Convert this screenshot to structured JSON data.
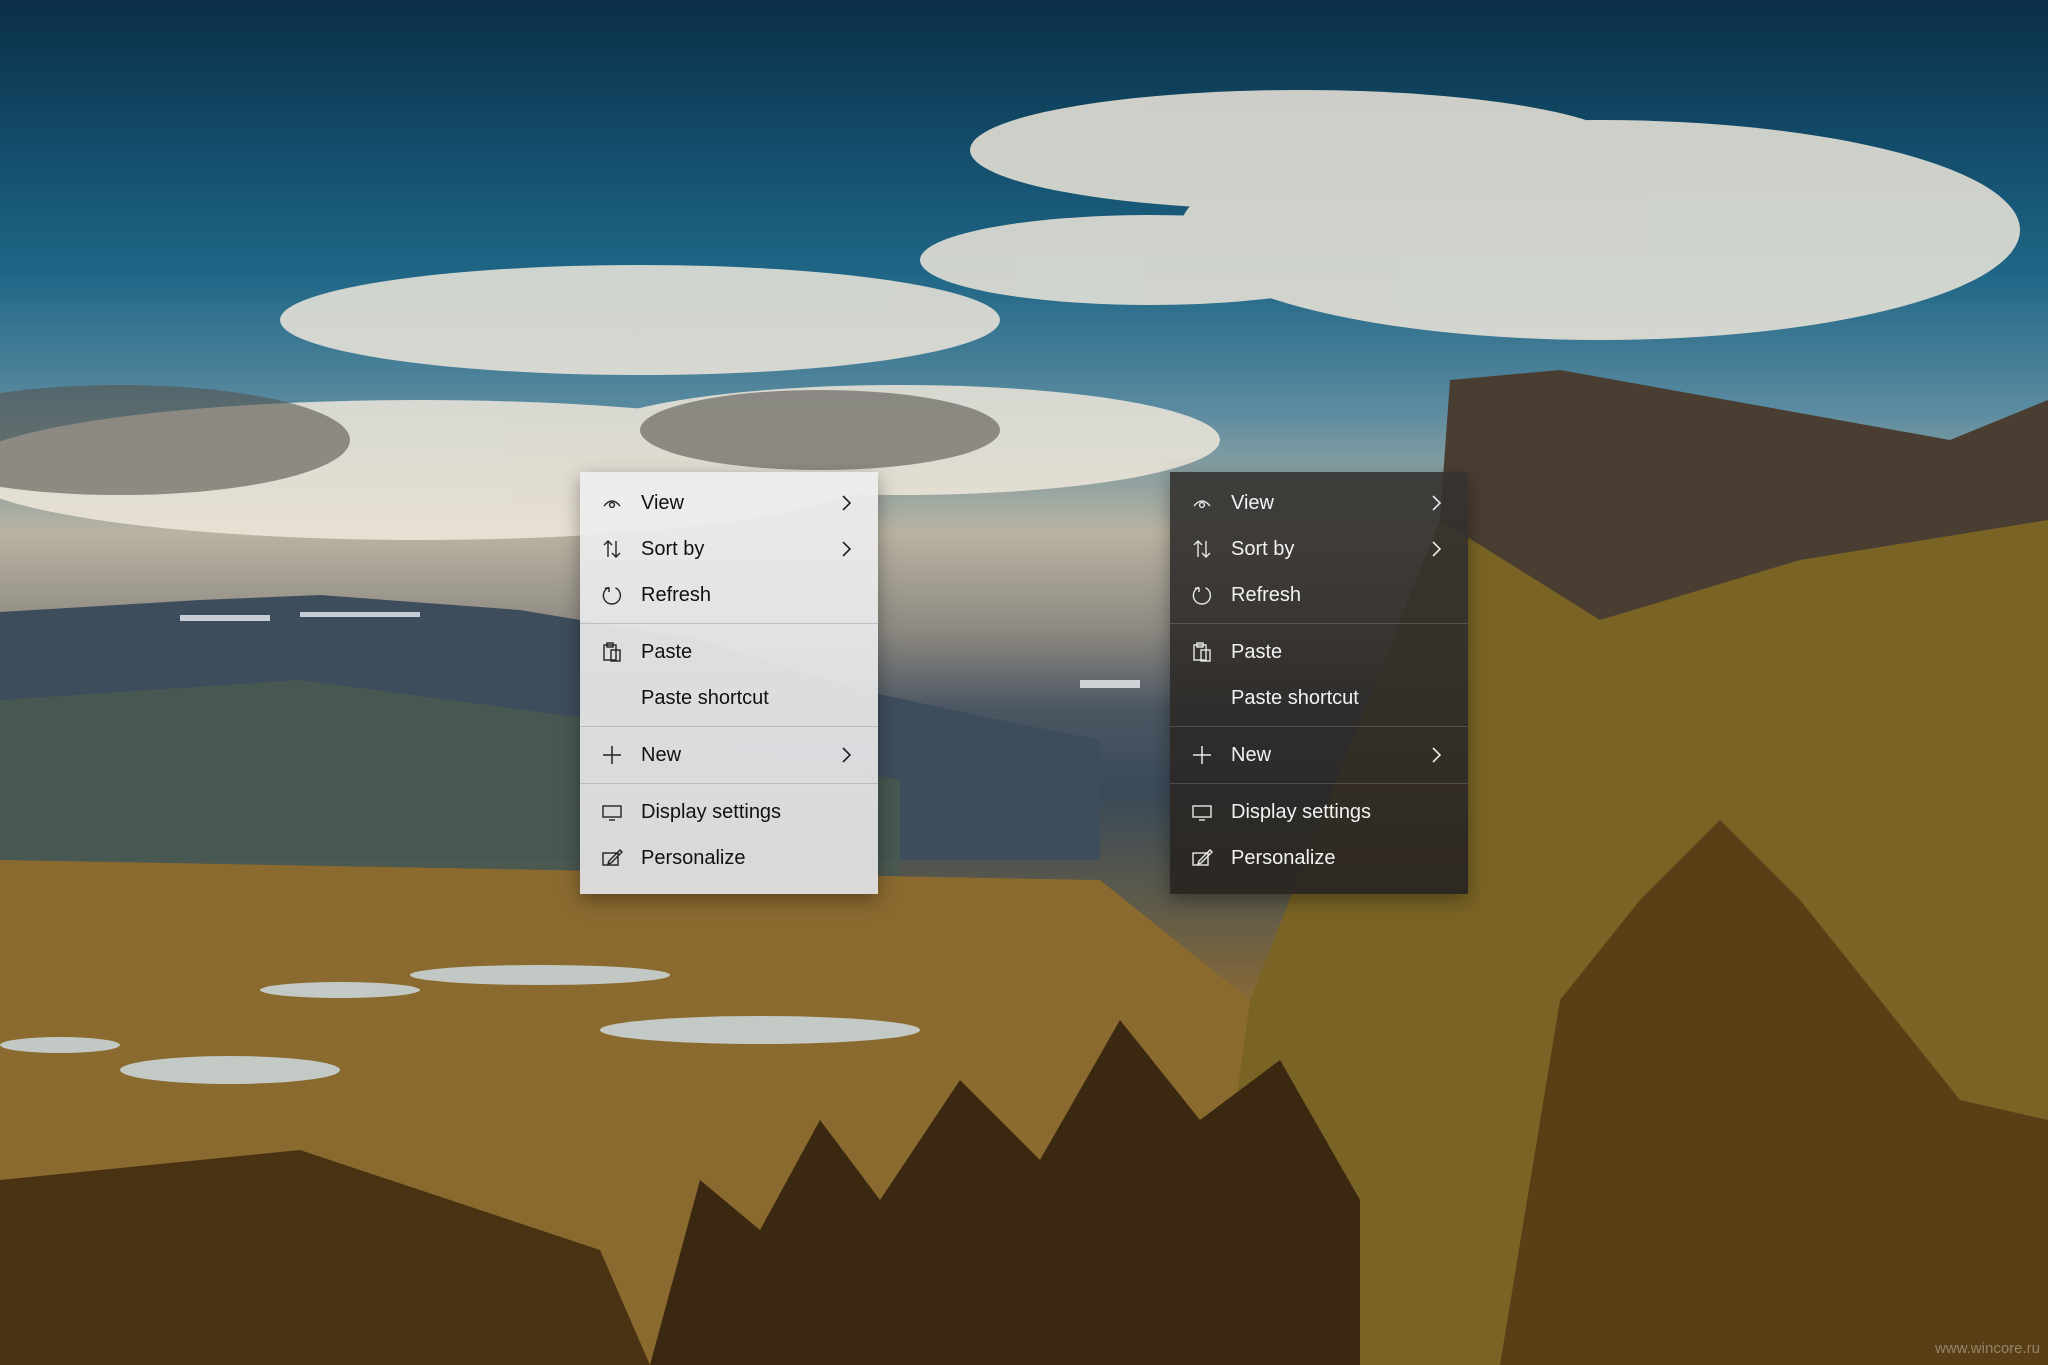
{
  "menus": {
    "light": {
      "theme": "light",
      "items": {
        "view": "View",
        "sort_by": "Sort by",
        "refresh": "Refresh",
        "paste": "Paste",
        "paste_shortcut": "Paste shortcut",
        "new": "New",
        "display_settings": "Display settings",
        "personalize": "Personalize"
      }
    },
    "dark": {
      "theme": "dark",
      "items": {
        "view": "View",
        "sort_by": "Sort by",
        "refresh": "Refresh",
        "paste": "Paste",
        "paste_shortcut": "Paste shortcut",
        "new": "New",
        "display_settings": "Display settings",
        "personalize": "Personalize"
      }
    }
  },
  "watermark": "www.wincore.ru",
  "colors": {
    "light_menu_bg": "#ececec",
    "dark_menu_bg": "#32302d",
    "light_text": "#111111",
    "dark_text": "#f2f2f2"
  },
  "icons": {
    "view": "eye-icon",
    "sort_by": "sort-arrows-icon",
    "refresh": "refresh-icon",
    "paste": "clipboard-icon",
    "new": "plus-icon",
    "display_settings": "monitor-icon",
    "personalize": "personalize-pen-icon",
    "submenu": "chevron-right-icon"
  }
}
